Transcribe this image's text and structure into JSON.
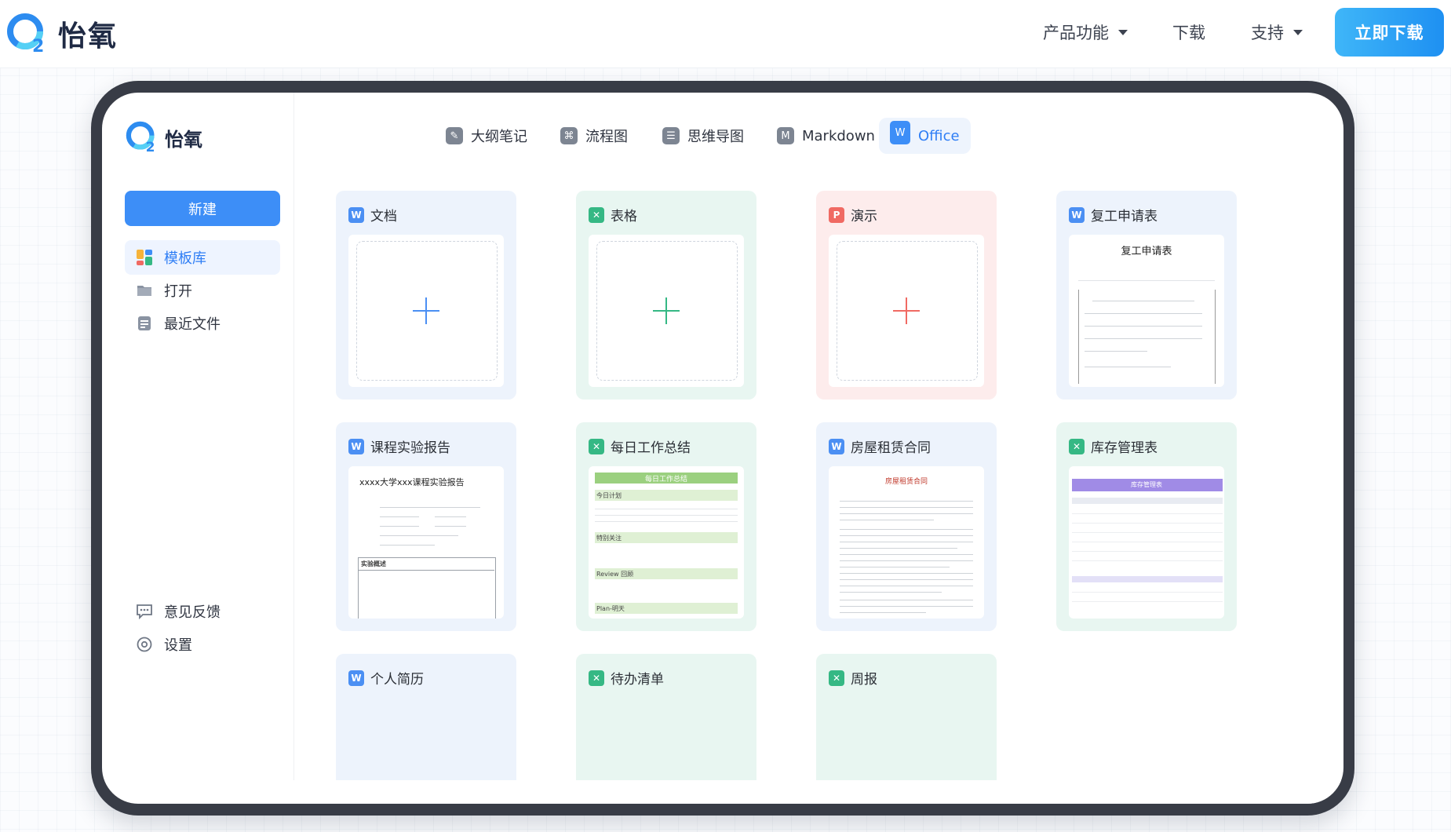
{
  "brand": {
    "name": "怡氧",
    "accent": "#2f7ef5"
  },
  "nav": {
    "items": [
      {
        "label": "产品功能",
        "has_menu": true
      },
      {
        "label": "下载",
        "has_menu": false
      },
      {
        "label": "支持",
        "has_menu": true
      }
    ],
    "download_label": "立即下载"
  },
  "sidebar": {
    "new_label": "新建",
    "items": [
      {
        "label": "模板库",
        "icon": "template-icon",
        "active": true
      },
      {
        "label": "打开",
        "icon": "folder-icon",
        "active": false
      },
      {
        "label": "最近文件",
        "icon": "recent-icon",
        "active": false
      }
    ],
    "bottom": [
      {
        "label": "意见反馈",
        "icon": "feedback-icon"
      },
      {
        "label": "设置",
        "icon": "settings-icon"
      }
    ]
  },
  "tabs": [
    {
      "label": "大纲笔记",
      "icon": "outline-icon"
    },
    {
      "label": "流程图",
      "icon": "flowchart-icon"
    },
    {
      "label": "思维导图",
      "icon": "mindmap-icon"
    },
    {
      "label": "Markdown",
      "icon": "markdown-icon"
    },
    {
      "label": "Office",
      "icon": "office-icon",
      "active": true
    }
  ],
  "cards": [
    {
      "title": "文档",
      "type": "w"
    },
    {
      "title": "表格",
      "type": "x"
    },
    {
      "title": "演示",
      "type": "p"
    },
    {
      "title": "复工申请表",
      "type": "w",
      "preview_title": "复工申请表"
    },
    {
      "title": "课程实验报告",
      "type": "w",
      "preview_title": "xxxx大学xxx课程实验报告",
      "preview_section": "实验概述"
    },
    {
      "title": "每日工作总结",
      "type": "x",
      "preview_title": "每日工作总结",
      "rows": [
        "今日计划",
        "特别关注",
        "Review 回顾",
        "Plan-明天"
      ]
    },
    {
      "title": "房屋租赁合同",
      "type": "w",
      "preview_title": "房屋租赁合同"
    },
    {
      "title": "库存管理表",
      "type": "x",
      "preview_title": "库存管理表"
    },
    {
      "title": "个人简历",
      "type": "w"
    },
    {
      "title": "待办清单",
      "type": "x"
    },
    {
      "title": "周报",
      "type": "x"
    }
  ]
}
